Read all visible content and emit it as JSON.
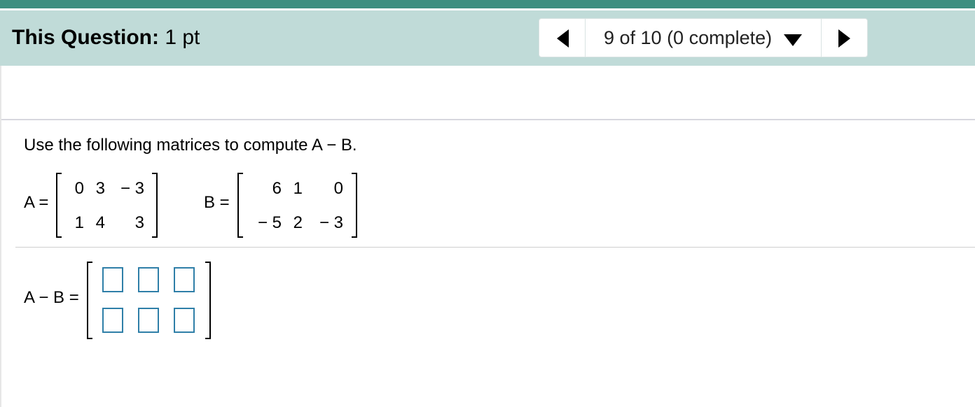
{
  "header": {
    "title_bold": "This Question:",
    "title_points": "1 pt",
    "nav": {
      "position_label": "9 of 10 (0 complete)"
    }
  },
  "question": {
    "prompt": "Use the following matrices to compute A − B.",
    "matrix_a": {
      "label": "A =",
      "rows": [
        [
          "0",
          "3",
          "− 3"
        ],
        [
          "1",
          "4",
          "3"
        ]
      ]
    },
    "matrix_b": {
      "label": "B =",
      "rows": [
        [
          "6",
          "1",
          "0"
        ],
        [
          "− 5",
          "2",
          "− 3"
        ]
      ]
    },
    "answer": {
      "label": "A − B =",
      "cells": [
        [
          "",
          "",
          ""
        ],
        [
          "",
          "",
          ""
        ]
      ]
    }
  },
  "icons": {
    "prev": "left-triangle-icon",
    "dropdown": "caret-down-icon",
    "next": "right-triangle-icon"
  },
  "colors": {
    "top_strip": "#3d8f80",
    "header_bg": "#c0dbd8",
    "answer_box_border": "#2f7fa8"
  }
}
